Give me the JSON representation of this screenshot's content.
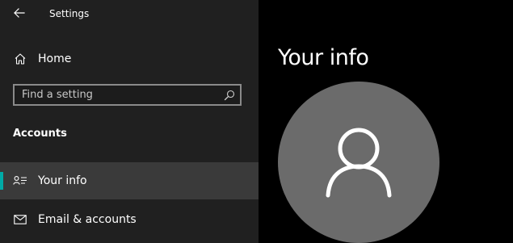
{
  "window": {
    "title": "Settings"
  },
  "sidebar": {
    "back_icon": "arrow-left-icon",
    "home": {
      "label": "Home",
      "icon": "home-icon"
    },
    "search": {
      "placeholder": "Find a setting",
      "value": "",
      "icon": "search-icon"
    },
    "section_heading": "Accounts",
    "items": [
      {
        "label": "Your info",
        "icon": "person-card-icon",
        "selected": true
      },
      {
        "label": "Email & accounts",
        "icon": "mail-icon",
        "selected": false
      }
    ]
  },
  "main": {
    "title": "Your info",
    "avatar_icon": "user-silhouette-icon"
  },
  "colors": {
    "sidebar_background": "#202020",
    "main_background": "#000000",
    "selected_item_background": "#3a3a3a",
    "accent": "#00aaa6",
    "avatar_background": "#6b6b6b"
  }
}
